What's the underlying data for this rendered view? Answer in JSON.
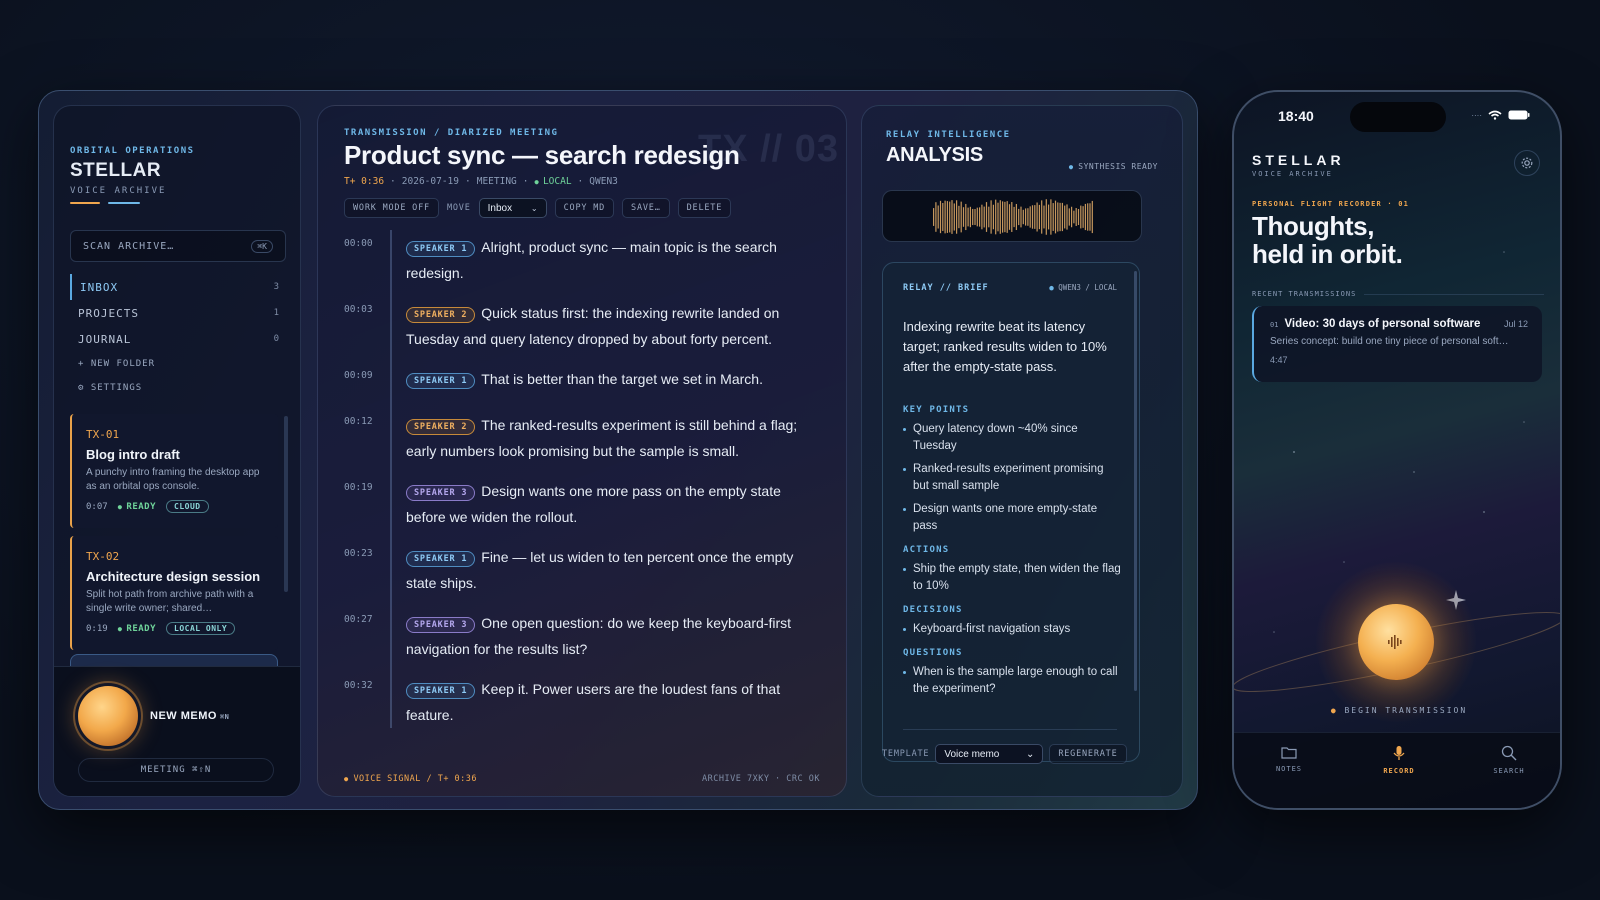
{
  "colors": {
    "accent_blue": "#6fb8e8",
    "accent_orange": "#f0a64e",
    "ready_green": "#6fd39a",
    "bg": "#0b1220"
  },
  "sidebar": {
    "eyebrow": "ORBITAL OPERATIONS",
    "title": "STELLAR",
    "subtitle": "VOICE ARCHIVE",
    "search_placeholder": "SCAN ARCHIVE…",
    "search_shortcut": "⌘K",
    "nav": [
      {
        "label": "INBOX",
        "count": "3"
      },
      {
        "label": "PROJECTS",
        "count": "1"
      },
      {
        "label": "JOURNAL",
        "count": "0"
      }
    ],
    "new_folder": "+ NEW FOLDER",
    "settings": "⚙ SETTINGS",
    "memos": [
      {
        "id": "TX-01",
        "title": "Blog intro draft",
        "desc": "A punchy intro framing the desktop app as an orbital ops console.",
        "duration": "0:07",
        "status": "READY",
        "tag": "CLOUD"
      },
      {
        "id": "TX-02",
        "title": "Architecture design session",
        "desc": "Split hot path from archive path with a single write owner; shared…",
        "duration": "0:19",
        "status": "READY",
        "tag": "LOCAL ONLY"
      }
    ],
    "new_memo": "NEW MEMO",
    "new_memo_shortcut": "⌘N",
    "meeting": "MEETING ⌘⇧N"
  },
  "transcript": {
    "eyebrow": "TRANSMISSION / DIARIZED MEETING",
    "title": "Product sync — search redesign",
    "watermark": "TX // 03",
    "meta": {
      "elapsed": "T+ 0:36",
      "date": "2026-07-19",
      "type": "MEETING",
      "mode": "LOCAL",
      "model": "QWEN3"
    },
    "toolbar": {
      "work_mode": "WORK MODE OFF",
      "move_label": "MOVE",
      "move_value": "Inbox",
      "copy_md": "COPY MD",
      "save": "SAVE…",
      "delete": "DELETE"
    },
    "segments": [
      {
        "time": "00:00",
        "speaker": "SPEAKER 1",
        "spk": 1,
        "text": "Alright, product sync — main topic is the search redesign."
      },
      {
        "time": "00:03",
        "speaker": "SPEAKER 2",
        "spk": 2,
        "text": "Quick status first: the indexing rewrite landed on Tuesday and query latency dropped by about forty percent."
      },
      {
        "time": "00:09",
        "speaker": "SPEAKER 1",
        "spk": 1,
        "text": "That is better than the target we set in March."
      },
      {
        "time": "00:12",
        "speaker": "SPEAKER 2",
        "spk": 2,
        "text": "The ranked-results experiment is still behind a flag; early numbers look promising but the sample is small."
      },
      {
        "time": "00:19",
        "speaker": "SPEAKER 3",
        "spk": 3,
        "text": "Design wants one more pass on the empty state before we widen the rollout."
      },
      {
        "time": "00:23",
        "speaker": "SPEAKER 1",
        "spk": 1,
        "text": "Fine — let us widen to ten percent once the empty state ships."
      },
      {
        "time": "00:27",
        "speaker": "SPEAKER 3",
        "spk": 3,
        "text": "One open question: do we keep the keyboard-first navigation for the results list?"
      },
      {
        "time": "00:32",
        "speaker": "SPEAKER 1",
        "spk": 1,
        "text": "Keep it. Power users are the loudest fans of that feature."
      }
    ],
    "footer_left": "VOICE SIGNAL / T+ 0:36",
    "footer_right": "ARCHIVE 7XKY · CRC OK"
  },
  "analysis": {
    "eyebrow": "RELAY INTELLIGENCE",
    "title": "ANALYSIS",
    "status": "SYNTHESIS READY",
    "brief_title": "RELAY // BRIEF",
    "brief_meta": "QWEN3 / LOCAL",
    "summary": "Indexing rewrite beat its latency target; ranked results widen to 10% after the empty-state pass.",
    "sections": [
      {
        "heading": "KEY POINTS",
        "items": [
          "Query latency down ~40% since Tuesday",
          "Ranked-results experiment promising but small sample",
          "Design wants one more empty-state pass"
        ]
      },
      {
        "heading": "ACTIONS",
        "items": [
          "Ship the empty state, then widen the flag to 10%"
        ]
      },
      {
        "heading": "DECISIONS",
        "items": [
          "Keyboard-first navigation stays"
        ]
      },
      {
        "heading": "QUESTIONS",
        "items": [
          "When is the sample large enough to call the experiment?"
        ]
      }
    ],
    "template_label": "TEMPLATE",
    "template_value": "Voice memo",
    "regenerate": "REGENERATE"
  },
  "phone": {
    "time": "18:40",
    "brand": "STELLAR",
    "brand_sub": "VOICE ARCHIVE",
    "eyebrow": "PERSONAL FLIGHT RECORDER · 01",
    "hero_line1": "Thoughts,",
    "hero_line2": "held in orbit.",
    "recent_label": "RECENT TRANSMISSIONS",
    "card": {
      "index": "01",
      "title": "Video: 30 days of personal software",
      "date": "Jul 12",
      "desc": "Series concept: build one tiny piece of personal soft…",
      "duration": "4:47"
    },
    "begin": "BEGIN TRANSMISSION",
    "tabs": [
      {
        "label": "NOTES",
        "icon": "folder-icon"
      },
      {
        "label": "RECORD",
        "icon": "mic-icon"
      },
      {
        "label": "SEARCH",
        "icon": "search-icon"
      }
    ]
  }
}
